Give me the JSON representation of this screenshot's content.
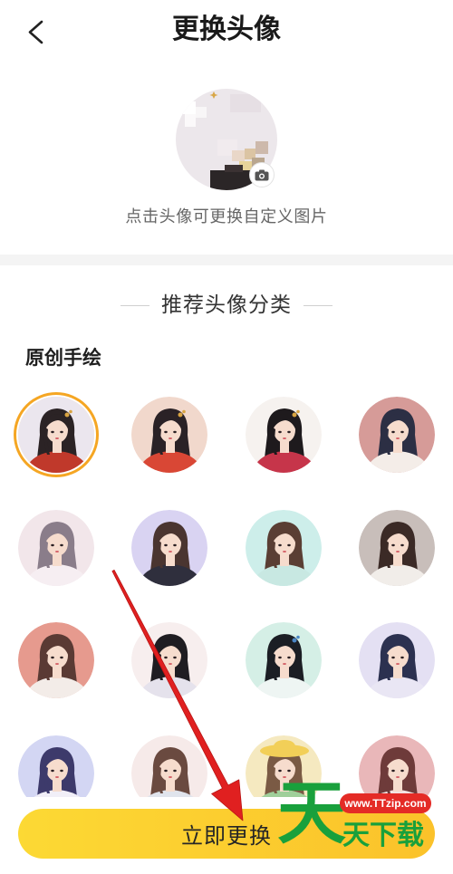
{
  "header": {
    "title": "更换头像",
    "back_icon": "chevron-left-icon"
  },
  "current_avatar": {
    "badge_icon": "camera-icon",
    "hint": "点击头像可更换自定义图片"
  },
  "recommend": {
    "title": "推荐头像分类"
  },
  "category": {
    "name": "原创手绘",
    "selected_index": 0,
    "avatars": [
      {
        "bg": "#ebe6ee",
        "hair": "#2b2325",
        "outfit": "#c0392b",
        "ornament": "#d9a441"
      },
      {
        "bg": "#f1d8cc",
        "hair": "#2a2226",
        "outfit": "#d94735",
        "ornament": "#d9a441"
      },
      {
        "bg": "#f6f2ef",
        "hair": "#1e1a1d",
        "outfit": "#c6354a",
        "ornament": "#d9a441"
      },
      {
        "bg": "#d69b98",
        "hair": "#2c2f44",
        "outfit": "#f4ede8"
      },
      {
        "bg": "#f2e6ea",
        "hair": "#8a7d8a",
        "outfit": "#f6eef2"
      },
      {
        "bg": "#d9d3f2",
        "hair": "#4a3530",
        "outfit": "#2f2f3d"
      },
      {
        "bg": "#cdeeea",
        "hair": "#5a3e34",
        "outfit": "#c8e8e2"
      },
      {
        "bg": "#c8beba",
        "hair": "#3b2a26",
        "outfit": "#f1ede9"
      },
      {
        "bg": "#e69a8e",
        "hair": "#5a3a34",
        "outfit": "#f3ece8"
      },
      {
        "bg": "#f7eeee",
        "hair": "#1f1d22",
        "outfit": "#e5e2ec"
      },
      {
        "bg": "#d5efe6",
        "hair": "#1b1e24",
        "outfit": "#eef5f3",
        "ornament": "#4a86c5"
      },
      {
        "bg": "#e4e0f3",
        "hair": "#2c3150",
        "outfit": "#e9e6f4"
      },
      {
        "bg": "#d3d6f3",
        "hair": "#3d3a6b",
        "outfit": "#f1eff7"
      },
      {
        "bg": "#f6eae9",
        "hair": "#6a4a40",
        "outfit": "#e0e4ec"
      },
      {
        "bg": "#f5e9c0",
        "hair": "#7a5a44",
        "outfit": "#9fcf9a",
        "hat": "#f2cf58"
      },
      {
        "bg": "#e9b7b9",
        "hair": "#6e3b3a",
        "outfit": "#f3e3e1"
      }
    ]
  },
  "action": {
    "confirm_label": "立即更换"
  },
  "watermark": {
    "mark": "天",
    "site": "www.TTzip.com",
    "text": "天下载"
  },
  "colors": {
    "accent_ring": "#f5a623",
    "button_from": "#fcd934",
    "button_to": "#fbc22a",
    "skin": "#f6dccd",
    "watermark_green": "#19a03c",
    "watermark_red": "#e42b26",
    "annotation_arrow": "#e02020"
  }
}
